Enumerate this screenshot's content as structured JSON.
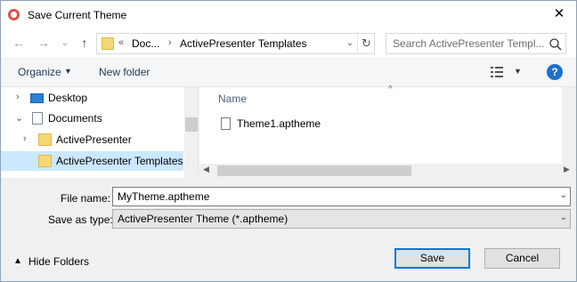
{
  "window": {
    "title": "Save Current Theme",
    "close_glyph": "✕"
  },
  "nav": {
    "back_glyph": "←",
    "forward_glyph": "→",
    "recent_glyph": "⌄",
    "up_glyph": "↑",
    "address": {
      "overflow": "«",
      "segments": [
        "Doc...",
        "ActivePresenter Templates"
      ],
      "separator": "›"
    },
    "search_placeholder": "Search ActivePresenter Templ..."
  },
  "toolbar": {
    "organize": "Organize",
    "new_folder": "New folder",
    "help": "?"
  },
  "tree": {
    "items": [
      {
        "label": "Desktop",
        "icon": "desktop-icon",
        "expander": "›",
        "indent": 0,
        "selected": false
      },
      {
        "label": "Documents",
        "icon": "documents-icon",
        "expander": "⌄",
        "indent": 0,
        "selected": false
      },
      {
        "label": "ActivePresenter",
        "icon": "folder-icon",
        "expander": "›",
        "indent": 1,
        "selected": false
      },
      {
        "label": "ActivePresenter Templates",
        "icon": "folder-icon",
        "expander": "",
        "indent": 1,
        "selected": true
      }
    ]
  },
  "file_list": {
    "column_name": "Name",
    "files": [
      {
        "name": "Theme1.aptheme",
        "icon": "file-icon"
      }
    ]
  },
  "form": {
    "file_name_label": "File name:",
    "file_name_value": "MyTheme.aptheme",
    "save_type_label": "Save as type:",
    "save_type_value": "ActivePresenter Theme (*.aptheme)"
  },
  "footer": {
    "hide_folders": "Hide Folders",
    "save": "Save",
    "cancel": "Cancel"
  },
  "colors": {
    "selection": "#cce8ff",
    "accent": "#0078d7",
    "help": "#1e6fd0",
    "link_text": "#1e395b"
  }
}
